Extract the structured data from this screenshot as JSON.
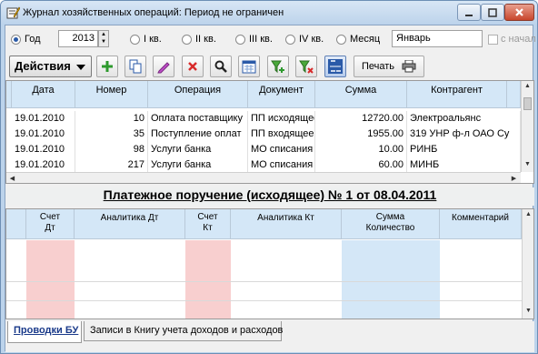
{
  "window": {
    "title": "Журнал хозяйственных операций: Период не ограничен",
    "controls": {
      "minimize_icon": "minimize-icon",
      "maximize_icon": "maximize-icon",
      "close_icon": "close-icon"
    }
  },
  "period": {
    "options": [
      {
        "label": "Год",
        "selected": true
      },
      {
        "label": "I кв.",
        "selected": false
      },
      {
        "label": "II кв.",
        "selected": false
      },
      {
        "label": "III кв.",
        "selected": false
      },
      {
        "label": "IV кв.",
        "selected": false
      },
      {
        "label": "Месяц",
        "selected": false
      }
    ],
    "year": "2013",
    "month": "Январь",
    "from_start_label": "с начал"
  },
  "toolbar": {
    "actions_label": "Действия",
    "print_label": "Печать",
    "icons": [
      "add-icon",
      "copy-icon",
      "edit-icon",
      "delete-icon",
      "search-icon",
      "calendar-icon",
      "filter-add-icon",
      "filter-remove-icon",
      "debit-credit-icon",
      "printer-icon"
    ]
  },
  "journal": {
    "columns": [
      "Дата",
      "Номер",
      "Операция",
      "Документ",
      "Сумма",
      "Контрагент"
    ],
    "rows": [
      [
        "19.01.2010",
        "10",
        "Оплата поставщику",
        "ПП исходящее",
        "12720.00",
        "Электроальянс"
      ],
      [
        "19.01.2010",
        "35",
        "Поступление оплат",
        "ПП входящее",
        "1955.00",
        "319 УНР ф-л ОАО Су"
      ],
      [
        "19.01.2010",
        "98",
        "Услуги банка",
        "МО списания д",
        "10.00",
        "РИНБ"
      ],
      [
        "19.01.2010",
        "217",
        "Услуги банка",
        "МО списания д",
        "60.00",
        "МИНБ"
      ]
    ]
  },
  "document_title": "Платежное поручение (исходящее) № 1 от 08.04.2011",
  "entries": {
    "columns": [
      "Счет Дт",
      "Аналитика Дт",
      "Счет Кт",
      "Аналитика Кт",
      "Сумма Количество",
      "Комментарий"
    ],
    "col_lines": [
      [
        "Счет",
        "Дт"
      ],
      [
        "Аналитика Дт"
      ],
      [
        "Счет",
        "Кт"
      ],
      [
        "Аналитика Кт"
      ],
      [
        "Сумма",
        "Количество"
      ],
      [
        "Комментарий"
      ]
    ]
  },
  "tabs": [
    {
      "label": "Проводки БУ",
      "active": true
    },
    {
      "label": "Записи в Книгу учета доходов и расходов",
      "active": false
    }
  ],
  "colors": {
    "header_bg": "#d4e7f7",
    "debit_bg": "#f8cfcf",
    "sum_bg": "#d4e7f7",
    "title_bar": "#bcd3eb"
  }
}
